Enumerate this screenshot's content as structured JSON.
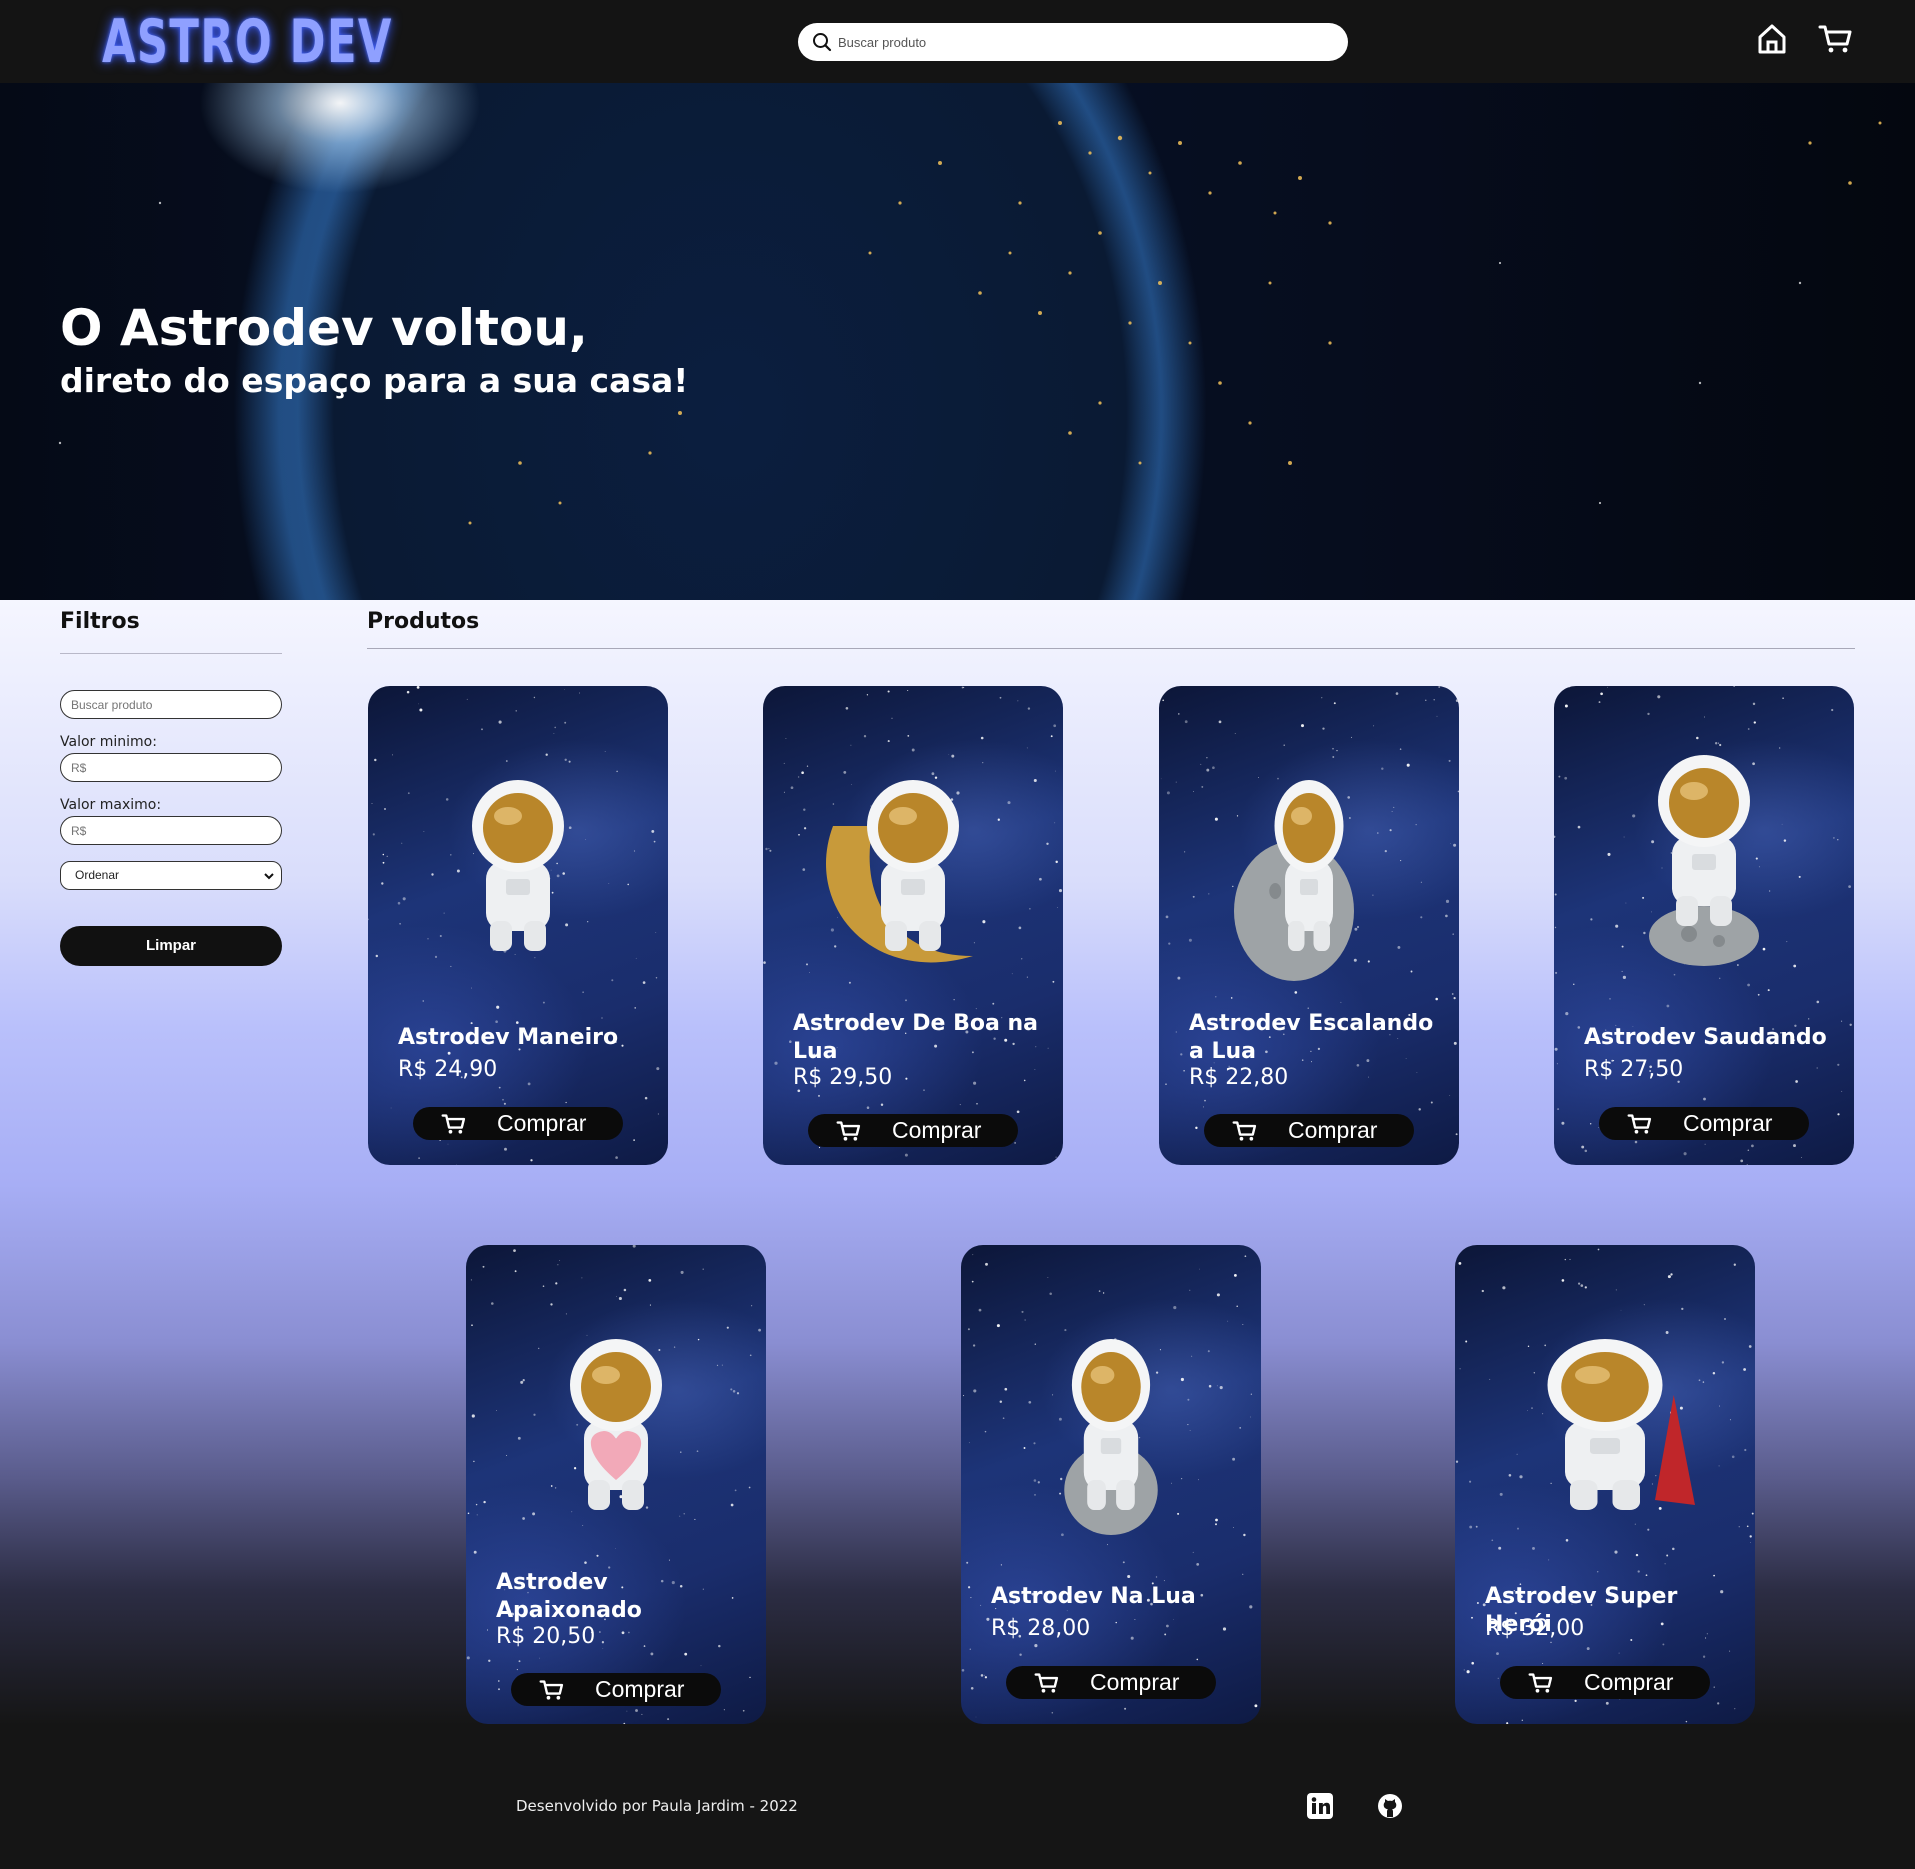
{
  "header": {
    "logo": "ASTRO DEV",
    "search_placeholder": "Buscar produto"
  },
  "hero": {
    "title": "O Astrodev voltou,",
    "subtitle": "direto do espaço para a sua casa!"
  },
  "filters": {
    "title": "Filtros",
    "search_placeholder": "Buscar produto",
    "min_label": "Valor minimo:",
    "min_placeholder": "R$",
    "max_label": "Valor maximo:",
    "max_placeholder": "R$",
    "sort_value": "Ordenar",
    "clear_label": "Limpar"
  },
  "products": {
    "title": "Produtos",
    "buy_label": "Comprar",
    "items": [
      {
        "name": "Astrodev Maneiro",
        "price": "R$ 24,90"
      },
      {
        "name": "Astrodev De Boa na Lua",
        "price": "R$ 29,50"
      },
      {
        "name": "Astrodev Escalando a Lua",
        "price": "R$ 22,80"
      },
      {
        "name": "Astrodev Saudando",
        "price": "R$ 27,50"
      },
      {
        "name": "Astrodev Apaixonado",
        "price": "R$ 20,50"
      },
      {
        "name": "Astrodev Na Lua",
        "price": "R$ 28,00"
      },
      {
        "name": "Astrodev Super Herói",
        "price": "R$ 32,00"
      }
    ]
  },
  "footer": {
    "credit": "Desenvolvido por Paula Jardim - 2022"
  },
  "icons": {
    "search": "search-icon",
    "home": "home-icon",
    "cart": "cart-icon",
    "linkedin": "linkedin-icon",
    "github": "github-icon"
  },
  "colors": {
    "logo": "#8fa0ff",
    "header_bg": "#141414",
    "button_bg": "#0b0b0b"
  }
}
